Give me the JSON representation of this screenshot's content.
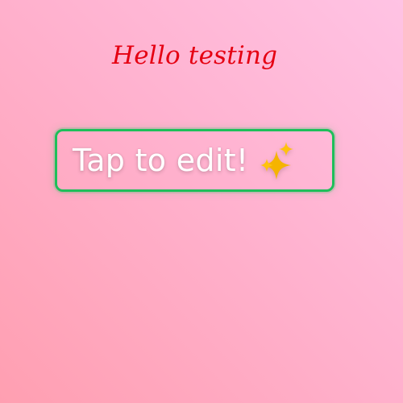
{
  "heading": {
    "text": "Hello testing",
    "color": "#e50012"
  },
  "editor": {
    "placeholder_text": "Tap to edit!",
    "border_color": "#1ebf5a",
    "icon": "sparkles-icon"
  },
  "background": {
    "colors": [
      "#ffc3e4",
      "#ffb2cf",
      "#ff9fb1"
    ]
  }
}
